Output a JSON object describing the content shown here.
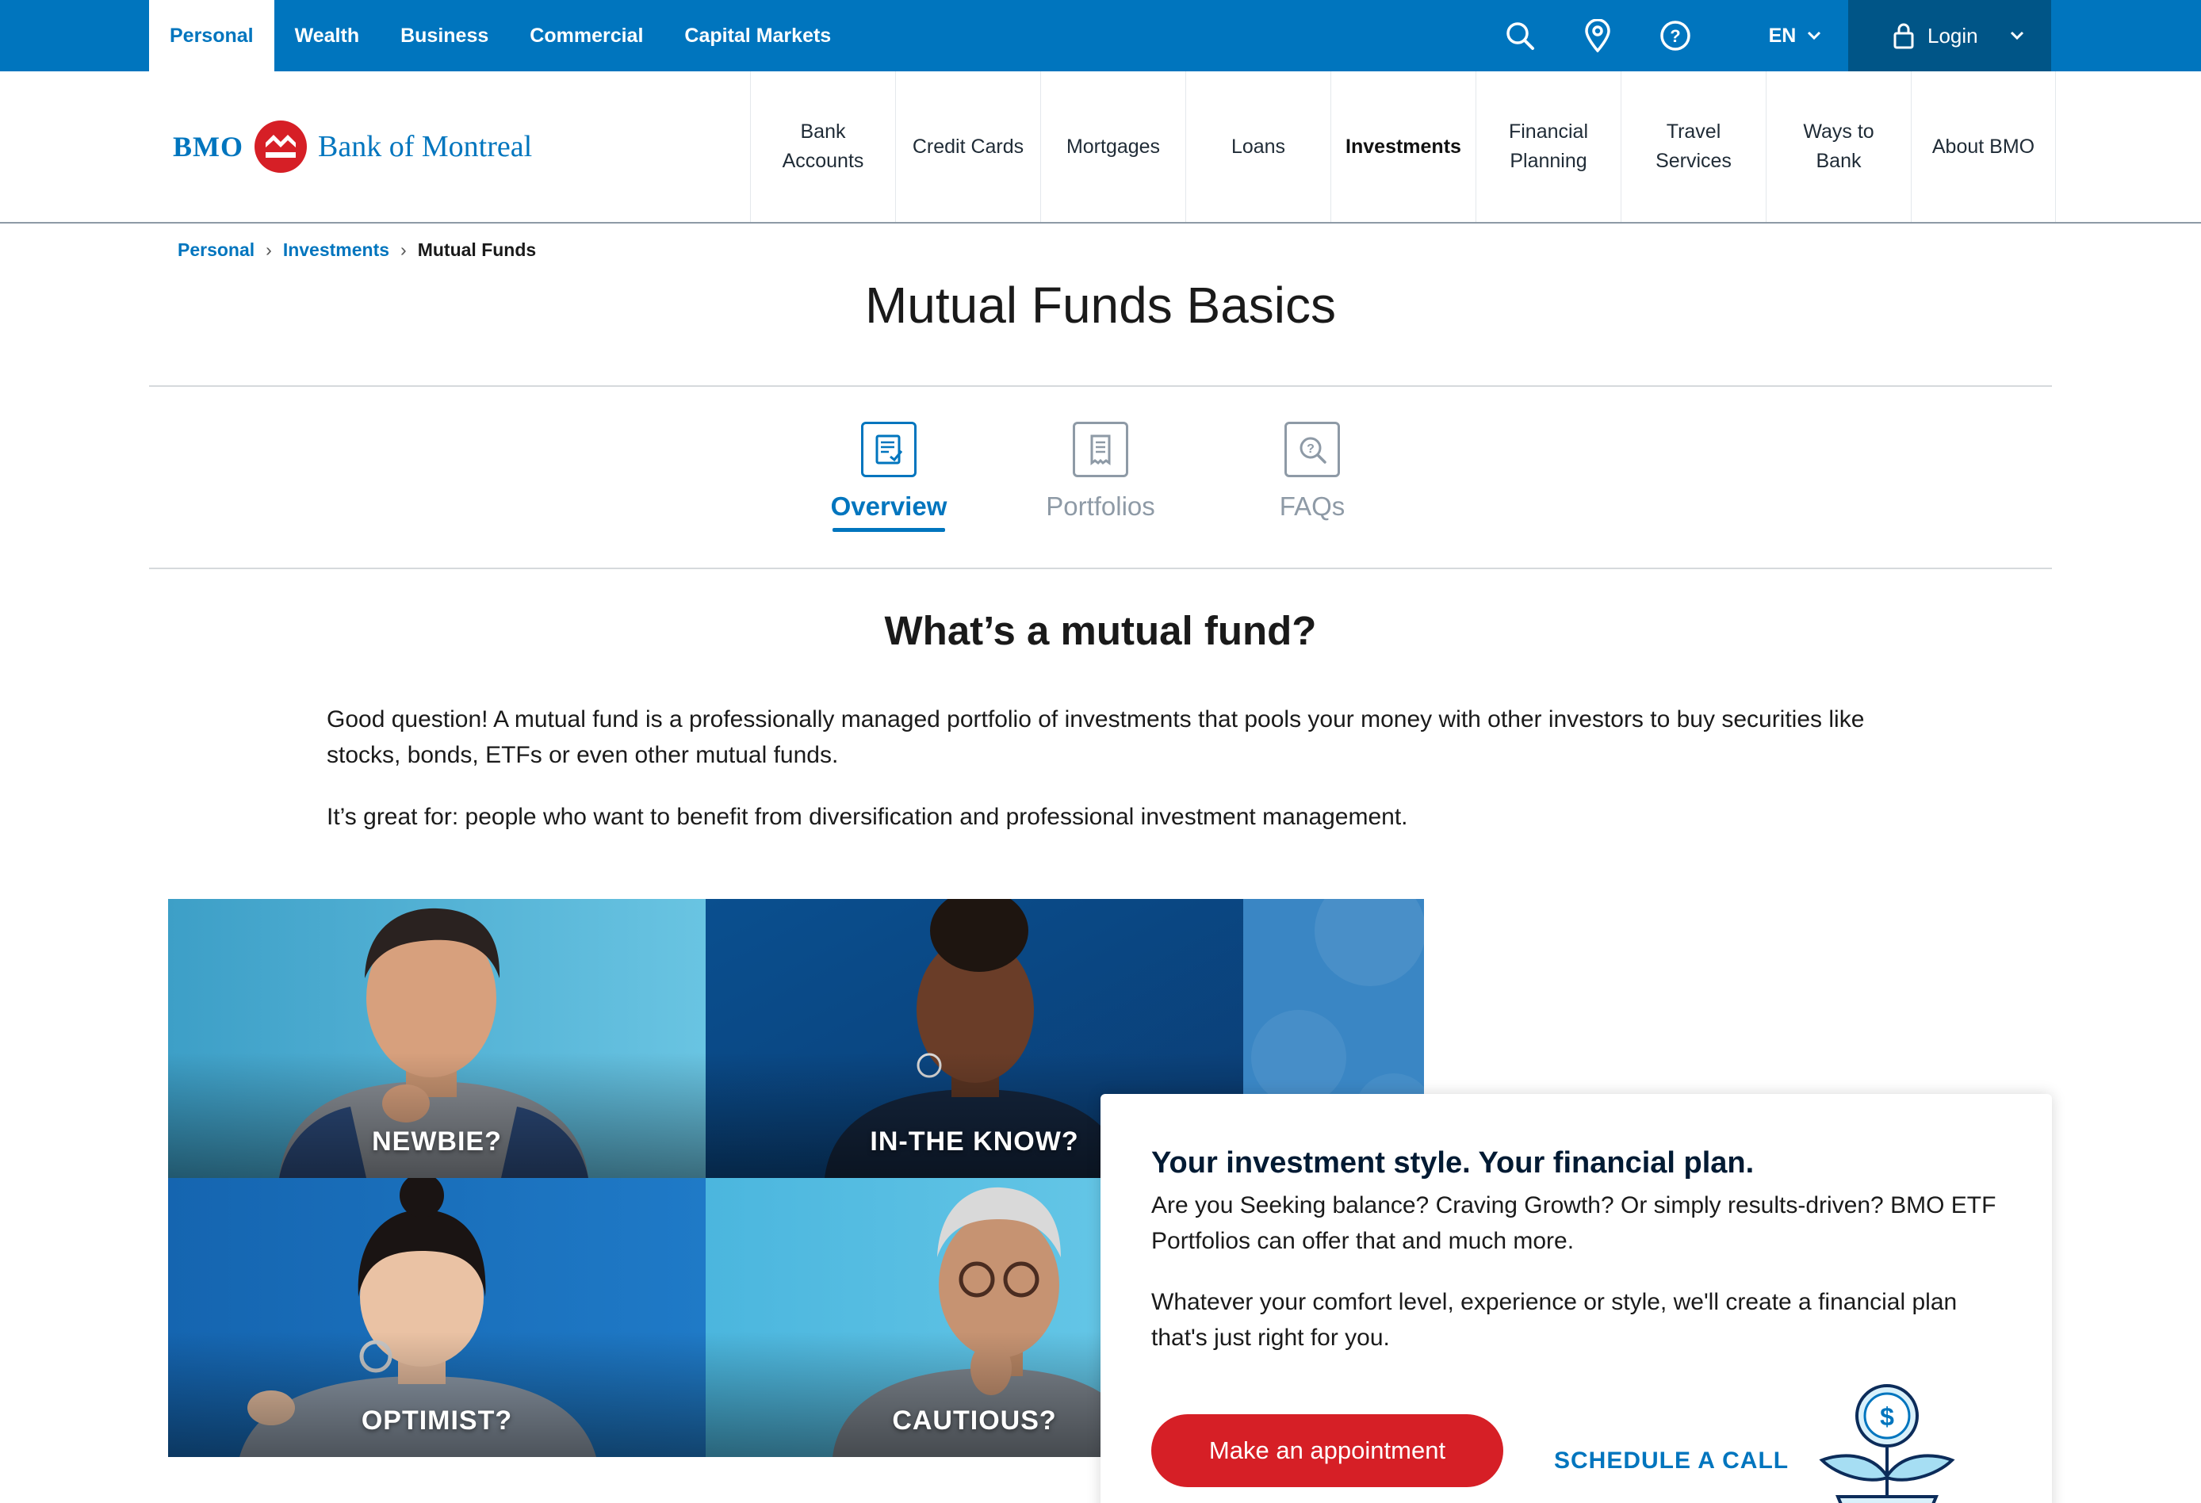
{
  "topnav": {
    "items": [
      {
        "label": "Personal",
        "active": true
      },
      {
        "label": "Wealth"
      },
      {
        "label": "Business"
      },
      {
        "label": "Commercial"
      },
      {
        "label": "Capital Markets"
      }
    ],
    "utility_icons": [
      "search-icon",
      "location-pin-icon",
      "help-icon"
    ],
    "language": "EN",
    "login_label": "Login"
  },
  "brand": {
    "short_name": "BMO",
    "full_name": "Bank of Montreal",
    "primary_color": "#0075be",
    "accent_color": "#d61f26"
  },
  "mainnav": {
    "items": [
      {
        "label": "Bank Accounts"
      },
      {
        "label": "Credit Cards"
      },
      {
        "label": "Mortgages"
      },
      {
        "label": "Loans"
      },
      {
        "label": "Investments",
        "active": true
      },
      {
        "label": "Financial Planning"
      },
      {
        "label": "Travel Services"
      },
      {
        "label": "Ways to Bank"
      },
      {
        "label": "About BMO"
      }
    ]
  },
  "breadcrumb": {
    "items": [
      "Personal",
      "Investments"
    ],
    "current": "Mutual Funds"
  },
  "page": {
    "title": "Mutual Funds Basics"
  },
  "tabs": [
    {
      "label": "Overview",
      "icon": "document-check-icon",
      "active": true
    },
    {
      "label": "Portfolios",
      "icon": "receipt-icon"
    },
    {
      "label": "FAQs",
      "icon": "question-search-icon"
    }
  ],
  "intro": {
    "heading": "What’s a mutual fund?",
    "paragraph1": "Good question! A mutual fund is a professionally managed portfolio of investments that pools your money with other investors to buy securities like stocks, bonds, ETFs or even other mutual funds.",
    "paragraph2": "It’s great for: people who want to benefit from diversification and professional investment management."
  },
  "personas": [
    {
      "caption": "NEWBIE?"
    },
    {
      "caption": "IN-THE KNOW?"
    },
    {
      "caption": "OPTIMIST?"
    },
    {
      "caption": "CAUTIOUS?"
    }
  ],
  "promo": {
    "title": "Your investment style. Your financial plan.",
    "paragraph1": "Are you Seeking balance? Craving Growth? Or simply results-driven? BMO ETF Portfolios can offer that and much more.",
    "paragraph2": "Whatever your comfort level, experience or style, we'll create a financial plan that's just right for you.",
    "primary_button": "Make an appointment",
    "secondary_link": "SCHEDULE A CALL",
    "illustration": "money-plant-icon"
  }
}
